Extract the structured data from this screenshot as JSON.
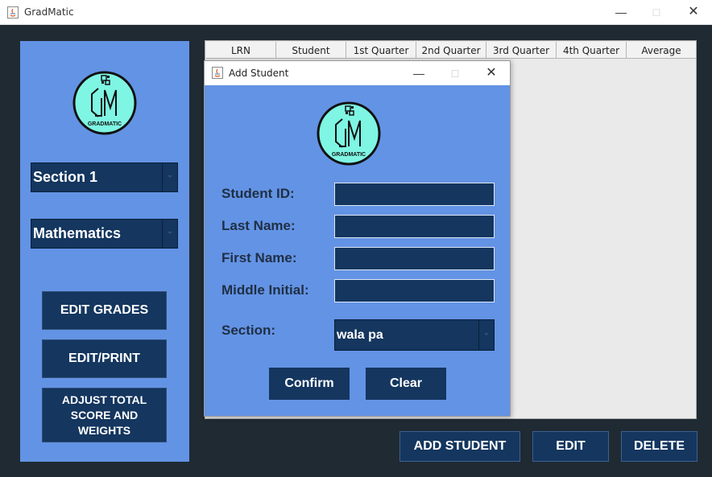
{
  "window": {
    "title": "GradMatic"
  },
  "logo": {
    "text": "GRADMATIC",
    "circle_color": "#7ff5e3"
  },
  "sidebar": {
    "section_combo": "Section 1",
    "subject_combo": "Mathematics",
    "buttons": [
      "EDIT GRADES",
      "EDIT/PRINT",
      "ADJUST TOTAL\nSCORE AND\nWEIGHTS"
    ]
  },
  "table": {
    "columns": [
      "LRN",
      "Student",
      "1st Quarter",
      "2nd Quarter",
      "3rd Quarter",
      "4th Quarter",
      "Average"
    ],
    "rows": []
  },
  "bottom_buttons": {
    "add": "ADD STUDENT",
    "edit": "EDIT",
    "delete": "DELETE"
  },
  "dialog": {
    "title": "Add Student",
    "labels": {
      "student_id": "Student ID:",
      "last_name": "Last Name:",
      "first_name": "First Name:",
      "middle_initial": "Middle Initial:",
      "section": "Section:"
    },
    "fields": {
      "student_id": "",
      "last_name": "",
      "first_name": "",
      "middle_initial": ""
    },
    "section_value": "wala pa",
    "confirm": "Confirm",
    "clear": "Clear"
  },
  "colors": {
    "panel_blue": "#6393e4",
    "navy": "#14365f",
    "background": "#1f2a33"
  }
}
